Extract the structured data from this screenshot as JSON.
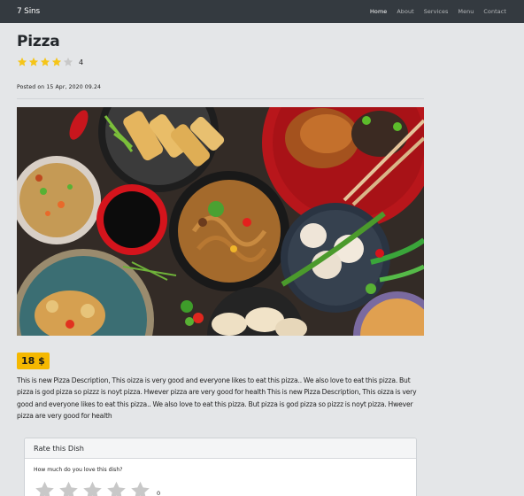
{
  "navbar": {
    "brand": "7 Sins",
    "links": [
      {
        "label": "Home",
        "active": true
      },
      {
        "label": "About",
        "active": false
      },
      {
        "label": "Services",
        "active": false
      },
      {
        "label": "Menu",
        "active": false
      },
      {
        "label": "Contact",
        "active": false
      }
    ]
  },
  "dish": {
    "title": "Pizza",
    "rating": {
      "value": 4,
      "max": 5,
      "count_text": "4"
    },
    "posted": "Posted on 15 Apr, 2020 09.24",
    "image_alt": "food-spread-photo",
    "price": "18 $",
    "description": "This is new Pizza Description, This oizza is very good and everyone likes to eat this pizza.. We also love to eat this pizza. But pizza is god pizza so pizzz is noyt pizza. Hwever pizza are very good for health This is new Pizza Description, This oizza is very good and everyone likes to eat this pizza.. We also love to eat this pizza. But pizza is god pizza so pizzz is noyt pizza. Hwever pizza are very good for health"
  },
  "rate_card": {
    "header": "Rate this Dish",
    "question": "How much do you love this dish?",
    "current_value": "0",
    "max_stars": 5
  },
  "colors": {
    "navbar_bg": "#343a40",
    "star_filled": "#f5c518",
    "star_empty": "#c8c8c8",
    "price_badge": "#f5b800",
    "page_bg": "#e4e6e8"
  },
  "icons": {
    "rating_star": "star-icon",
    "rate_star": "star-outline-icon"
  }
}
